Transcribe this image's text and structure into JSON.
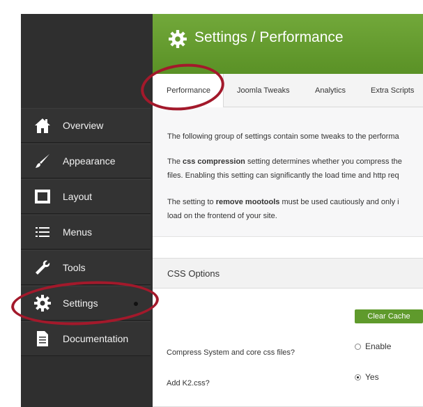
{
  "header": {
    "title": "Settings / Performance"
  },
  "sidebar": {
    "items": [
      {
        "label": "Overview",
        "icon": "home-icon"
      },
      {
        "label": "Appearance",
        "icon": "brush-icon"
      },
      {
        "label": "Layout",
        "icon": "layout-icon"
      },
      {
        "label": "Menus",
        "icon": "list-icon"
      },
      {
        "label": "Tools",
        "icon": "wrench-icon"
      },
      {
        "label": "Settings",
        "icon": "gear-icon"
      },
      {
        "label": "Documentation",
        "icon": "document-icon"
      }
    ]
  },
  "tabs": [
    {
      "label": "Performance",
      "active": true
    },
    {
      "label": "Joomla Tweaks"
    },
    {
      "label": "Analytics"
    },
    {
      "label": "Extra Scripts"
    }
  ],
  "intro": {
    "p1": "The following group of settings contain some tweaks to the performa",
    "p2a": "The ",
    "p2b": "css compression",
    "p2c": " setting determines whether you compress the",
    "p2d": "files. Enabling this setting can significantly the load time and http req",
    "p3a": "The setting to ",
    "p3b": "remove mootools",
    "p3c": " must be used cautiously and only i",
    "p3d": "load on the frontend of your site."
  },
  "section": {
    "title": "CSS Options"
  },
  "options": {
    "clear_cache": "Clear Cache",
    "q1": "Compress System and core css files?",
    "q1_option": "Enable",
    "q2": "Add K2.css?",
    "q2_option": "Yes"
  },
  "colors": {
    "accent_green": "#5f9a2c",
    "highlight_red": "#a3192b",
    "sidebar": "#333333"
  }
}
